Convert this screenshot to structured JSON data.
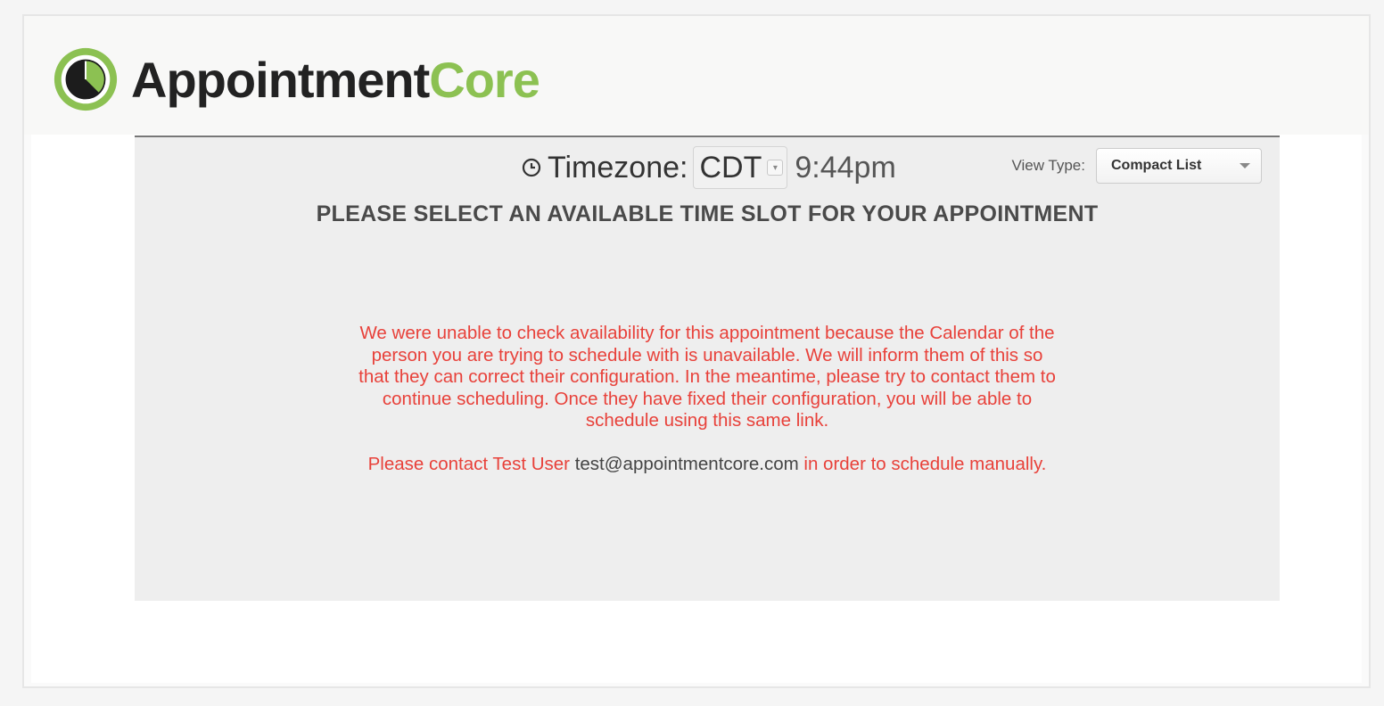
{
  "logo": {
    "text_primary": "Appointment",
    "text_accent": "Core",
    "icon": "clock-logo-icon",
    "colors": {
      "primary": "#222222",
      "accent": "#8cc152"
    }
  },
  "timezone": {
    "icon": "clock-icon",
    "label": "Timezone:",
    "value": "CDT",
    "time": "9:44pm"
  },
  "view_type": {
    "label": "View Type:",
    "value": "Compact List"
  },
  "heading": "PLEASE SELECT AN AVAILABLE TIME SLOT FOR YOUR APPOINTMENT",
  "error": {
    "message": "We were unable to check availability for this appointment because the Calendar of the person you are trying to schedule with is unavailable. We will inform them of this so that they can correct their configuration. In the meantime, please try to contact them to continue scheduling. Once they have fixed their configuration, you will be able to schedule using this same link.",
    "contact_prefix": "Please contact Test User",
    "contact_email": "test@appointmentcore.com",
    "contact_suffix": "in order to schedule manually.",
    "color": "#e8413a"
  }
}
